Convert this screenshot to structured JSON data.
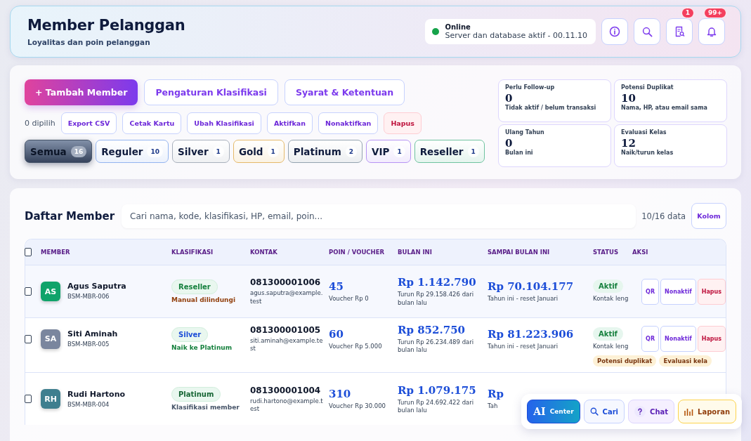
{
  "header": {
    "title": "Member Pelanggan",
    "subtitle": "Loyalitas dan poin pelanggan",
    "status": {
      "label": "Online",
      "detail": "Server dan database aktif - 00.11.10",
      "color": "#16a34a"
    },
    "icon_buttons": [
      {
        "kind": "info"
      },
      {
        "kind": "search"
      },
      {
        "kind": "report",
        "badge": "1"
      },
      {
        "kind": "bell",
        "badge": "99+"
      }
    ]
  },
  "actions": {
    "primary": "+ Tambah Member",
    "secondary": [
      "Pengaturan Klasifikasi",
      "Syarat & Ketentuan"
    ],
    "selected_count": "0 dipilih",
    "bulk": [
      {
        "label": "Export CSV",
        "kind": "normal"
      },
      {
        "label": "Cetak Kartu",
        "kind": "normal"
      },
      {
        "label": "Ubah Klasifikasi",
        "kind": "normal"
      },
      {
        "label": "Aktifkan",
        "kind": "normal"
      },
      {
        "label": "Nonaktifkan",
        "kind": "normal"
      },
      {
        "label": "Hapus",
        "kind": "danger"
      }
    ],
    "filters": [
      {
        "label": "Semua",
        "count": "16",
        "selected": true,
        "color": "#475569"
      },
      {
        "label": "Reguler",
        "count": "10",
        "selected": false,
        "color": "#93b4f0"
      },
      {
        "label": "Silver",
        "count": "1",
        "selected": false,
        "color": "#a8b0bc"
      },
      {
        "label": "Gold",
        "count": "1",
        "selected": false,
        "color": "#e5b96a"
      },
      {
        "label": "Platinum",
        "count": "2",
        "selected": false,
        "color": "#94a3b0"
      },
      {
        "label": "VIP",
        "count": "1",
        "selected": false,
        "color": "#b794f4"
      },
      {
        "label": "Reseller",
        "count": "1",
        "selected": false,
        "color": "#6fc3a0"
      }
    ]
  },
  "stats": [
    {
      "label": "Perlu Follow-up",
      "value": "0",
      "note": "Tidak aktif / belum transaksi"
    },
    {
      "label": "Potensi Duplikat",
      "value": "10",
      "note": "Nama, HP, atau email sama"
    },
    {
      "label": "Ulang Tahun",
      "value": "0",
      "note": "Bulan ini"
    },
    {
      "label": "Evaluasi Kelas",
      "value": "12",
      "note": "Naik/turun kelas"
    }
  ],
  "list": {
    "title": "Daftar Member",
    "search": {
      "placeholder": "Cari nama, kode, klasifikasi, HP, email, poin..."
    },
    "count": "10/16 data",
    "columns_button": "Kolom",
    "header_checked": false,
    "columns": [
      "MEMBER",
      "KLASIFIKASI",
      "KONTAK",
      "POIN / VOUCHER",
      "BULAN INI",
      "SAMPAI BULAN INI",
      "STATUS",
      "AKSI"
    ],
    "rows": [
      {
        "checked": false,
        "initials": "AS",
        "color": "#10a36a",
        "name": "Agus Saputra",
        "code": "BSM-MBR-006",
        "class": {
          "label": "Reseller",
          "color": "#15803d"
        },
        "class_note": {
          "text": "Manual dilindungi",
          "color": "#92400e"
        },
        "phone": "081300001006",
        "email": "agus.saputra@example.test",
        "points": "45",
        "voucher": "Voucher Rp 0",
        "month": "Rp 1.142.790",
        "month_note": "Turun Rp 29.158.426 dari bulan lalu",
        "total": "Rp 70.104.177",
        "total_note": "Tahun ini - reset Januari",
        "status": "Aktif",
        "status_note": "Kontak leng",
        "tags": [],
        "actions": [
          {
            "label": "QR",
            "kind": "normal"
          },
          {
            "label": "Nonaktif",
            "kind": "normal"
          },
          {
            "label": "Hapus",
            "kind": "danger"
          }
        ]
      },
      {
        "checked": false,
        "initials": "SA",
        "color": "#7a869e",
        "name": "Siti Aminah",
        "code": "BSM-MBR-005",
        "class": {
          "label": "Silver",
          "color": "#1d4ed8"
        },
        "class_note": {
          "text": "Naik ke Platinum",
          "color": "#15803d"
        },
        "phone": "081300001005",
        "email": "siti.aminah@example.test",
        "points": "60",
        "voucher": "Voucher Rp 5.000",
        "month": "Rp 852.750",
        "month_note": "Turun Rp 26.234.489 dari bulan lalu",
        "total": "Rp 81.223.906",
        "total_note": "Tahun ini - reset Januari",
        "status": "Aktif",
        "status_note": "Kontak leng",
        "tags": [
          "Potensi duplikat",
          "Evaluasi kela"
        ],
        "actions": [
          {
            "label": "QR",
            "kind": "normal"
          },
          {
            "label": "Nonaktif",
            "kind": "normal"
          },
          {
            "label": "Hapus",
            "kind": "danger"
          }
        ]
      },
      {
        "checked": false,
        "initials": "RH",
        "color": "#3f7f8f",
        "name": "Rudi Hartono",
        "code": "BSM-MBR-004",
        "class": {
          "label": "Platinum",
          "color": "#166534"
        },
        "class_note": {
          "text": "Klasifikasi member",
          "color": "#475569"
        },
        "phone": "081300001004",
        "email": "rudi.hartono@example.test",
        "points": "310",
        "voucher": "Voucher Rp 30.000",
        "month": "Rp 1.079.175",
        "month_note": "Turun Rp 24.692.422 dari bulan lalu",
        "total": "Rp",
        "total_note": "Tah",
        "tags": [],
        "actions": []
      }
    ]
  },
  "dock": [
    {
      "kind": "ai",
      "badge": "AI",
      "label": "Center"
    },
    {
      "kind": "search",
      "label": "Cari"
    },
    {
      "kind": "chat",
      "label": "Chat"
    },
    {
      "kind": "report",
      "label": "Laporan"
    }
  ]
}
